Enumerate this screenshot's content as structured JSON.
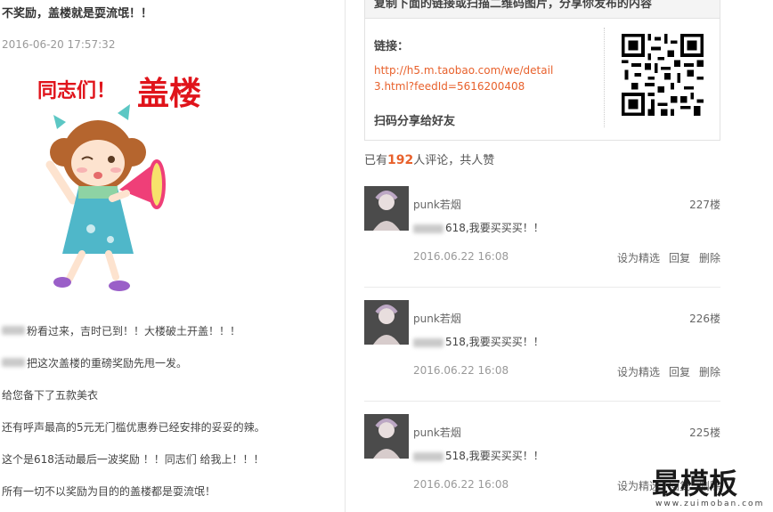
{
  "post": {
    "title": "不奖励，盖楼就是耍流氓！！",
    "time": "2016-06-20 17:57:32",
    "banner_text": "同志们！",
    "banner_big": "盖楼",
    "paragraphs": [
      "粉看过来，吉时已到！！大楼破土开盖！！！",
      "把这次盖楼的重磅奖励先甩一发。",
      "给您备下了五款美衣",
      "还有呼声最高的5元无门槛优惠券已经安排的妥妥的辣。",
      "这个是618活动最后一波奖励 ！！同志们 给我上！！！",
      "所有一切不以奖励为目的的盖楼都是耍流氓！"
    ]
  },
  "share": {
    "heading": "复制下面的链接或扫描二维码图片，分享你发布的内容",
    "link_label": "链接：",
    "url": "http://h5.m.taobao.com/we/detail3.html?feedId=5616200408",
    "tip": "扫码分享给好友"
  },
  "summary": {
    "prefix": "已有",
    "count": "192",
    "suffix": "人评论，共人赞"
  },
  "comments": [
    {
      "user": "punk若烟",
      "floor": "227楼",
      "text": "618,我要买买买！！",
      "date": "2016.06.22 16:08",
      "actions": [
        "设为精选",
        "回复",
        "删除"
      ]
    },
    {
      "user": "punk若烟",
      "floor": "226楼",
      "text": "518,我要买买买！！",
      "date": "2016.06.22 16:08",
      "actions": [
        "设为精选",
        "回复",
        "删除"
      ]
    },
    {
      "user": "punk若烟",
      "floor": "225楼",
      "text": "518,我要买买买！！",
      "date": "2016.06.22 16:08",
      "actions": [
        "设为精选",
        "回复",
        "删除"
      ]
    }
  ],
  "watermark": {
    "big": "最模板",
    "small": "www.zuimoban.com"
  },
  "colors": {
    "accent": "#e8612c",
    "banner_red": "#e0141b"
  }
}
